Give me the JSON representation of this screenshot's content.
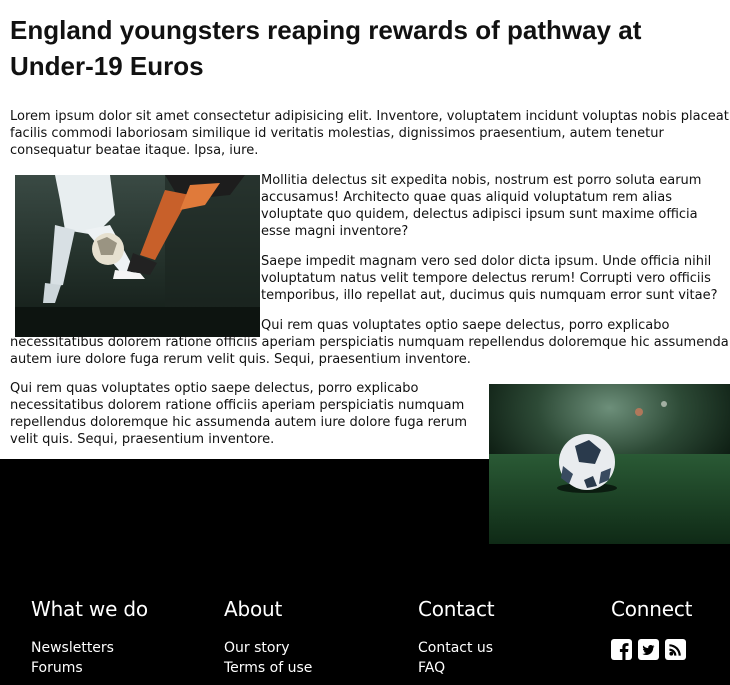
{
  "article": {
    "title": "England youngsters reaping rewards of pathway at Under-19 Euros",
    "paragraphs": [
      "Lorem ipsum dolor sit amet consectetur adipisicing elit. Inventore, voluptatem incidunt voluptas nobis placeat facilis commodi laboriosam similique id veritatis molestias, dignissimos praesentium, autem tenetur consequatur beatae itaque. Ipsa, iure.",
      "Mollitia delectus sit expedita nobis, nostrum est porro soluta earum accusamus! Architecto quae quas aliquid voluptatum rem alias voluptate quo quidem, delectus adipisci ipsum sunt maxime officia esse magni inventore?",
      "Saepe impedit magnam vero sed dolor dicta ipsum. Unde officia nihil voluptatum natus velit tempore delectus rerum! Corrupti vero officiis temporibus, illo repellat aut, ducimus quis numquam error sunt vitae?",
      "Qui rem quas voluptates optio saepe delectus, porro explicabo necessitatibus dolorem ratione officiis aperiam perspiciatis numquam repellendus doloremque hic assumenda autem iure dolore fuga rerum velit quis. Sequi, praesentium inventore.",
      "Qui rem quas voluptates optio saepe delectus, porro explicabo necessitatibus dolorem ratione officiis aperiam perspiciatis numquam repellendus doloremque hic assumenda autem iure dolore fuga rerum velit quis. Sequi, praesentium inventore."
    ]
  },
  "footer": {
    "what_we_do": {
      "heading": "What we do",
      "links": [
        "Newsletters",
        "Forums"
      ]
    },
    "about": {
      "heading": "About",
      "links": [
        "Our story",
        "Terms of use"
      ]
    },
    "contact": {
      "heading": "Contact",
      "links": [
        "Contact us",
        "FAQ"
      ]
    },
    "connect": {
      "heading": "Connect",
      "icons": [
        "facebook-icon",
        "twitter-icon",
        "rss-icon"
      ]
    }
  }
}
